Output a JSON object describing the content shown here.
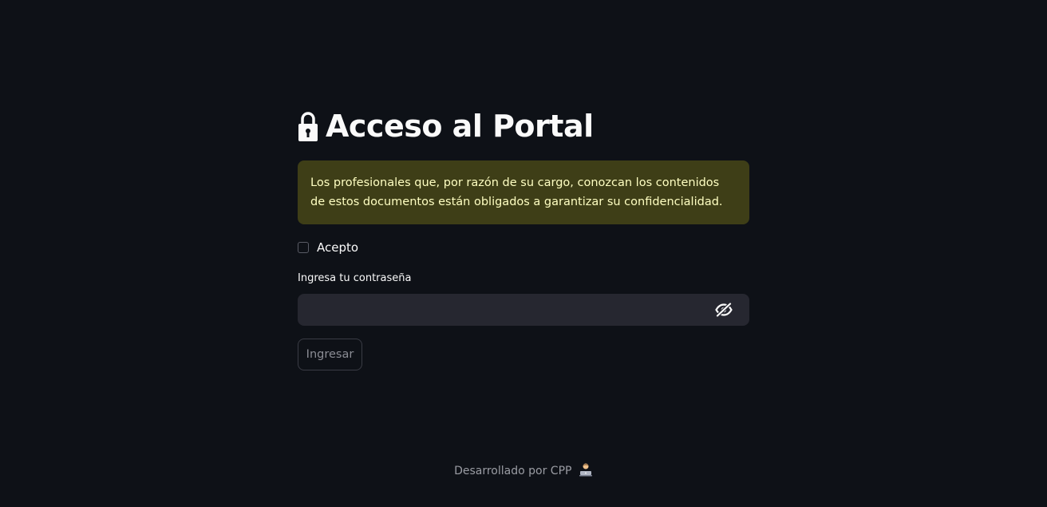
{
  "header": {
    "title": "Acceso al Portal",
    "icon": "lock-icon"
  },
  "notice": {
    "text": "Los profesionales que, por razón de su cargo, conozcan los contenidos de estos documentos están obligados a garantizar su confidencialidad.",
    "background": "#3e3e17",
    "text_color": "#ffffc2"
  },
  "agreement": {
    "label": "Acepto",
    "checked": false
  },
  "password": {
    "label": "Ingresa tu contraseña",
    "value": "",
    "toggle_icon": "eye-slash-icon"
  },
  "submit": {
    "label": "Ingresar"
  },
  "footer": {
    "text": "Desarrollado por CPP",
    "icon": "technologist-emoji-icon"
  },
  "colors": {
    "page_background": "#0e1117",
    "input_background": "#262730",
    "text_primary": "#fafafa",
    "text_muted": "#9a9ca3"
  }
}
